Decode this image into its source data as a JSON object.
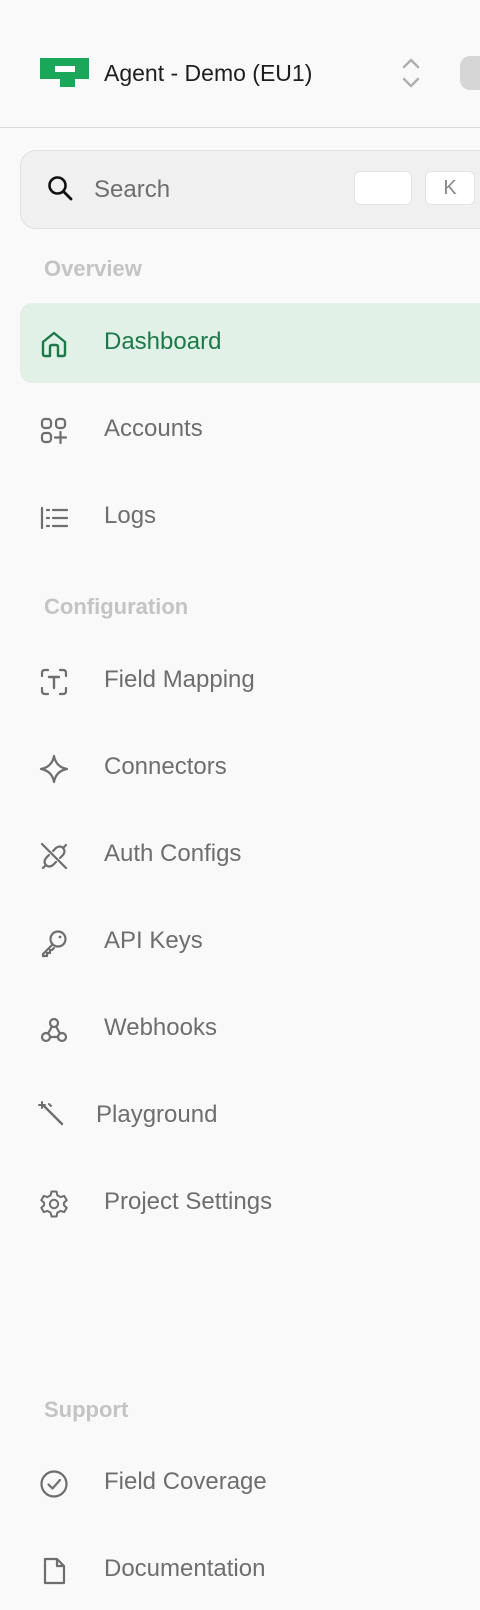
{
  "header": {
    "title": "Agent - Demo (EU1)",
    "brand_color": "#1aa75a"
  },
  "search": {
    "placeholder": "Search",
    "shortcut_key": "K"
  },
  "sections": {
    "overview": "Overview",
    "configuration": "Configuration",
    "support": "Support"
  },
  "nav": {
    "overview": [
      {
        "label": "Dashboard",
        "icon": "home-icon",
        "active": true
      },
      {
        "label": "Accounts",
        "icon": "accounts-icon"
      },
      {
        "label": "Logs",
        "icon": "list-icon"
      }
    ],
    "configuration": [
      {
        "label": "Field Mapping",
        "icon": "text-field-icon"
      },
      {
        "label": "Connectors",
        "icon": "sparkle-icon"
      },
      {
        "label": "Auth Configs",
        "icon": "plug-icon"
      },
      {
        "label": "API Keys",
        "icon": "key-icon"
      },
      {
        "label": "Webhooks",
        "icon": "webhook-icon"
      },
      {
        "label": "Playground",
        "icon": "magic-wand-icon"
      },
      {
        "label": "Project Settings",
        "icon": "gear-icon"
      }
    ],
    "support": [
      {
        "label": "Field Coverage",
        "icon": "check-circle-icon"
      },
      {
        "label": "Documentation",
        "icon": "document-icon"
      }
    ]
  },
  "colors": {
    "active_bg": "#e1f1e8",
    "active_text": "#1d7a48",
    "text": "#6e6e6e",
    "section": "#c4c4c4"
  }
}
